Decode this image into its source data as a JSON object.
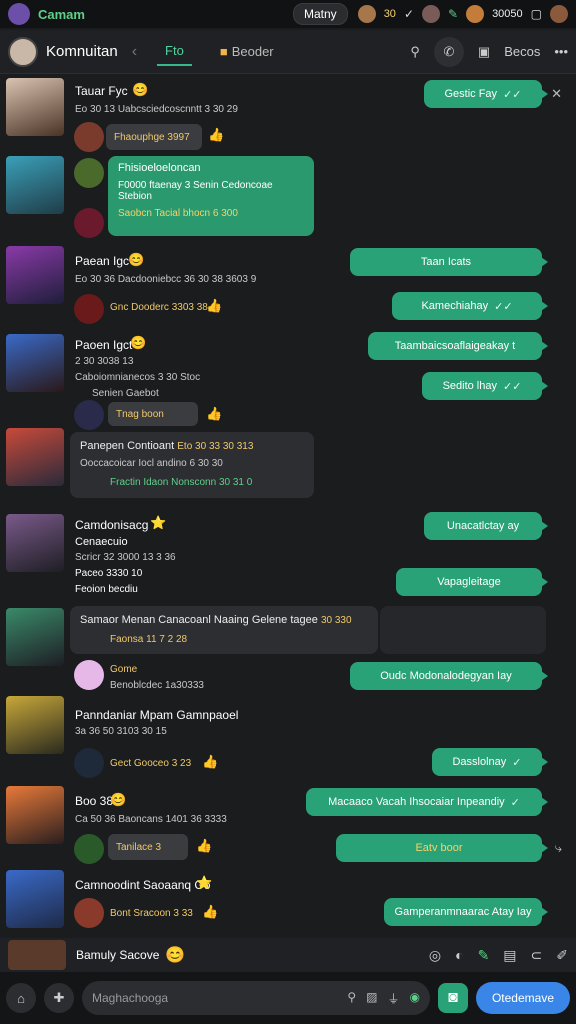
{
  "status": {
    "app_name": "Camam",
    "center_pill": "Matny",
    "counter": "30",
    "score": "30050"
  },
  "header": {
    "title": "Komnuitan",
    "tab_active": "Fto",
    "tab_other": "Beoder",
    "right_label": "Becos"
  },
  "messages": [
    {
      "name": "Tauar Fyc",
      "meta": "Eo 30 13 Uabcsciedcoscnntt 3 30 29",
      "pill": "Fhaouphge 3997"
    },
    {
      "green_title": "Fhisioeloeloncan",
      "green_line1": "F0000 ftaenay 3 Senin Cedoncoae",
      "green_line2": "Stebion",
      "green_line3": "Saobcn  Tacial bhocn 6 300"
    },
    {
      "name": "Paean Igc",
      "meta": "Eo 30 36 Dacdooniebcc 36 30 38 3603 9",
      "pill": "Gnc Dooderc 3303 38"
    },
    {
      "name": "Paoen Igct",
      "meta1": "2 30 3038 13",
      "meta2": "Caboiomnianecos 3 30 Stoc",
      "meta3": "Senien Gaebot",
      "pill": "Tnag boon"
    },
    {
      "name": "Panepen Contioant",
      "name_extra": "Eto 30 33 30 313",
      "meta": "Ooccacoicar Iocl andino 6 30 30",
      "pill": "Fractin Idaon  Nonsconn 30 31 0"
    },
    {
      "name": "Camdonisacg",
      "meta1": "Cenaecuio",
      "meta2": "Scricr 32 3000 13 3 36",
      "meta3": "Paceo 3330 10",
      "meta4": "Feoion becdiu"
    },
    {
      "name": "Samaor Menan Canacoanl Naaing Gelene tagee",
      "name_extra": "30 330",
      "meta": "Faonsa 11 7 2 28"
    },
    {
      "name": "Gome",
      "meta": "Benoblcdec 1a30333"
    },
    {
      "name": "Panndaniar Mpam Gamnpaoel",
      "meta": "3a 36 50 3103 30 15",
      "pill": "Gect Gooceo 3 23"
    },
    {
      "name": "Boo 38",
      "meta": "Ca 50 36 Baoncans 1401 36 3333",
      "pill": "Tanilace 3"
    },
    {
      "name": "Camnoodint Saoaanq Go",
      "pill": "Bont Sracoon 3 33"
    }
  ],
  "outgoing": [
    "Gestic Fay",
    "Taan Icats",
    "Kamechiahay",
    "Taambaicsoaflaigeakay t",
    "Sedito lhay",
    "Unacatlctay ay",
    "Vapagleitage",
    "Oudc Modonalodegyan Iay",
    "Dasslolnay",
    "Macaaco Vacah Ihsocaiar Inpeandiy",
    "Eatv boor",
    "Gamperanmnaarac Atay Iay"
  ],
  "bottom_bar": {
    "label": "Bamuly Sacove"
  },
  "composer": {
    "placeholder": "Maghachooga",
    "send_label": "Otedemave"
  }
}
